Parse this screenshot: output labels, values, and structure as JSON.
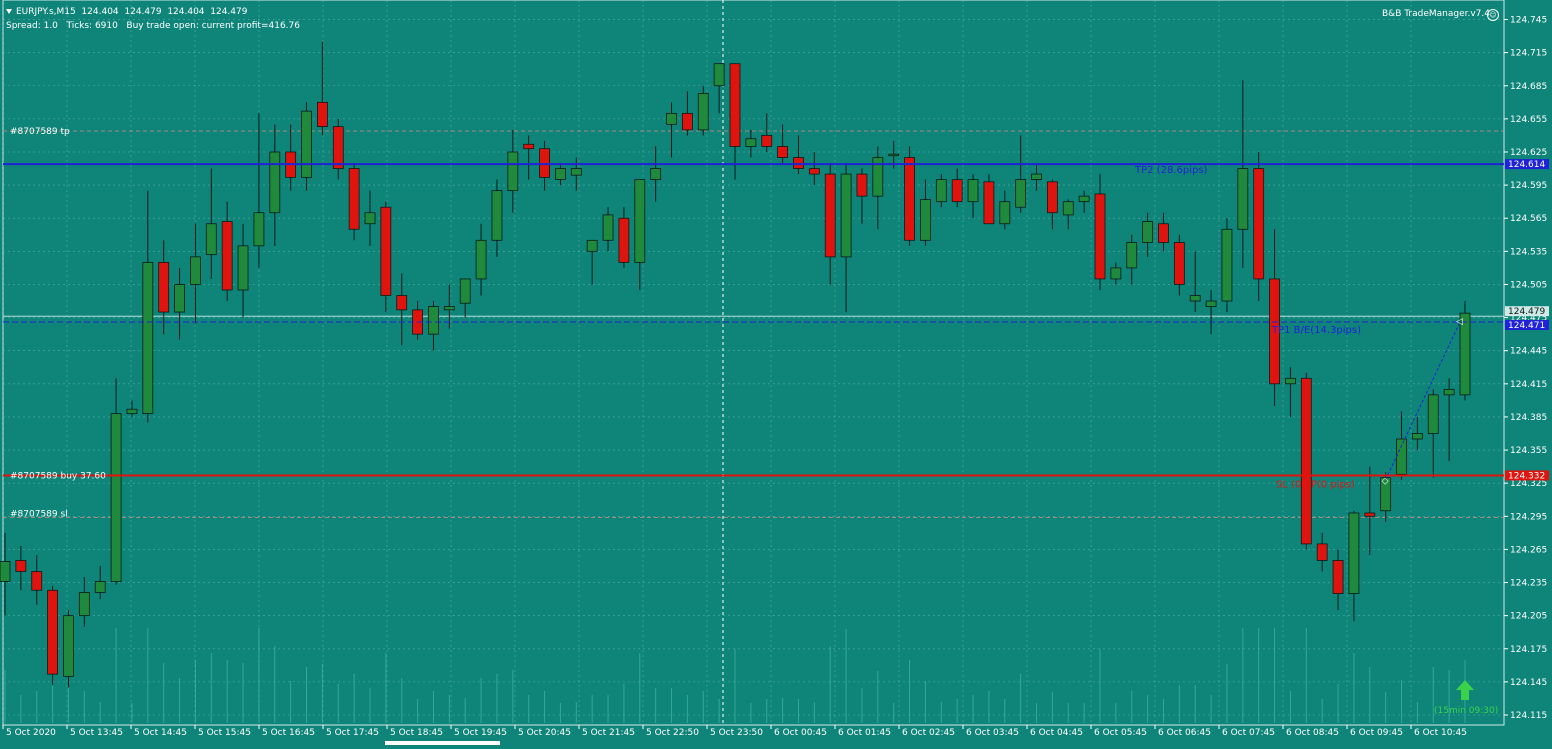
{
  "header": {
    "symbol_line": "EURJPY.s,M15  124.404  124.479  124.404  124.479",
    "info_line": "Spread: 1.0   Ticks: 6910   Buy trade open: current profit=416.76"
  },
  "panel": {
    "title": "B&B TradeManager.v7.4",
    "icon": "smiley-icon"
  },
  "orders": {
    "tp_label": "#8707589 tp",
    "buy_label": "#8707589 buy 37.60",
    "sl_label": "#8707589 sl",
    "tp2_label": "TP2 (28.6pips)",
    "tp1_label": "TP1 B/E(14.3pips)",
    "sl_label2": "SL (0.4P(0 pips)"
  },
  "countdown": "(15min 09:30)",
  "colors": {
    "background": "#0f857a",
    "bull": "#1f8a3b",
    "bear": "#e0140f",
    "tp_line": "#1f22d6",
    "sl_line": "#e0140f",
    "grid": "#7fc8c0"
  },
  "chart_data": {
    "type": "candlestick",
    "symbol": "EURJPY.s",
    "timeframe": "M15",
    "ylim": [
      124.115,
      124.75
    ],
    "y_ticks": [
      "124.745",
      "124.715",
      "124.685",
      "124.655",
      "124.625",
      "124.595",
      "124.565",
      "124.535",
      "124.505",
      "124.475",
      "124.445",
      "124.415",
      "124.385",
      "124.355",
      "124.325",
      "124.295",
      "124.265",
      "124.235",
      "124.205",
      "124.175",
      "124.145",
      "124.115"
    ],
    "x_ticks": [
      "5 Oct 2020",
      "5 Oct 13:45",
      "5 Oct 14:45",
      "5 Oct 15:45",
      "5 Oct 16:45",
      "5 Oct 17:45",
      "5 Oct 18:45",
      "5 Oct 19:45",
      "5 Oct 20:45",
      "5 Oct 21:45",
      "5 Oct 22:50",
      "5 Oct 23:50",
      "6 Oct 00:45",
      "6 Oct 01:45",
      "6 Oct 02:45",
      "6 Oct 03:45",
      "6 Oct 04:45",
      "6 Oct 05:45",
      "6 Oct 06:45",
      "6 Oct 07:45",
      "6 Oct 08:45",
      "6 Oct 09:45",
      "6 Oct 10:45"
    ],
    "price_labels": {
      "tp": "124.614",
      "bid": "124.479",
      "tp1": "124.471",
      "entry": "124.332"
    },
    "levels": {
      "tp": 124.614,
      "tp1": 124.471,
      "entry": 124.332,
      "sl": 124.294,
      "tp_dash": 124.644,
      "bid": 124.479
    },
    "candles": [
      {
        "o": 124.236,
        "h": 124.28,
        "l": 124.205,
        "c": 124.254
      },
      {
        "o": 124.255,
        "h": 124.268,
        "l": 124.228,
        "c": 124.245
      },
      {
        "o": 124.245,
        "h": 124.26,
        "l": 124.215,
        "c": 124.228
      },
      {
        "o": 124.228,
        "h": 124.232,
        "l": 124.142,
        "c": 124.152
      },
      {
        "o": 124.15,
        "h": 124.21,
        "l": 124.14,
        "c": 124.205
      },
      {
        "o": 124.205,
        "h": 124.24,
        "l": 124.195,
        "c": 124.226
      },
      {
        "o": 124.226,
        "h": 124.25,
        "l": 124.22,
        "c": 124.236
      },
      {
        "o": 124.236,
        "h": 124.42,
        "l": 124.233,
        "c": 124.388
      },
      {
        "o": 124.388,
        "h": 124.4,
        "l": 124.385,
        "c": 124.392
      },
      {
        "o": 124.388,
        "h": 124.59,
        "l": 124.38,
        "c": 124.525
      },
      {
        "o": 124.525,
        "h": 124.545,
        "l": 124.46,
        "c": 124.48
      },
      {
        "o": 124.48,
        "h": 124.52,
        "l": 124.455,
        "c": 124.505
      },
      {
        "o": 124.505,
        "h": 124.56,
        "l": 124.47,
        "c": 124.53
      },
      {
        "o": 124.532,
        "h": 124.61,
        "l": 124.51,
        "c": 124.56
      },
      {
        "o": 124.562,
        "h": 124.58,
        "l": 124.49,
        "c": 124.5
      },
      {
        "o": 124.5,
        "h": 124.56,
        "l": 124.475,
        "c": 124.54
      },
      {
        "o": 124.54,
        "h": 124.66,
        "l": 124.52,
        "c": 124.57
      },
      {
        "o": 124.57,
        "h": 124.65,
        "l": 124.54,
        "c": 124.625
      },
      {
        "o": 124.625,
        "h": 124.65,
        "l": 124.59,
        "c": 124.602
      },
      {
        "o": 124.602,
        "h": 124.67,
        "l": 124.59,
        "c": 124.662
      },
      {
        "o": 124.67,
        "h": 124.725,
        "l": 124.64,
        "c": 124.648
      },
      {
        "o": 124.648,
        "h": 124.655,
        "l": 124.6,
        "c": 124.61
      },
      {
        "o": 124.61,
        "h": 124.615,
        "l": 124.545,
        "c": 124.555
      },
      {
        "o": 124.56,
        "h": 124.59,
        "l": 124.54,
        "c": 124.57
      },
      {
        "o": 124.575,
        "h": 124.58,
        "l": 124.48,
        "c": 124.495
      },
      {
        "o": 124.495,
        "h": 124.515,
        "l": 124.45,
        "c": 124.482
      },
      {
        "o": 124.482,
        "h": 124.49,
        "l": 124.455,
        "c": 124.46
      },
      {
        "o": 124.46,
        "h": 124.49,
        "l": 124.445,
        "c": 124.485
      },
      {
        "o": 124.482,
        "h": 124.505,
        "l": 124.465,
        "c": 124.485
      },
      {
        "o": 124.488,
        "h": 124.51,
        "l": 124.475,
        "c": 124.51
      },
      {
        "o": 124.51,
        "h": 124.56,
        "l": 124.495,
        "c": 124.545
      },
      {
        "o": 124.545,
        "h": 124.6,
        "l": 124.53,
        "c": 124.59
      },
      {
        "o": 124.59,
        "h": 124.645,
        "l": 124.57,
        "c": 124.625
      },
      {
        "o": 124.632,
        "h": 124.64,
        "l": 124.6,
        "c": 124.628
      },
      {
        "o": 124.628,
        "h": 124.635,
        "l": 124.59,
        "c": 124.602
      },
      {
        "o": 124.6,
        "h": 124.615,
        "l": 124.595,
        "c": 124.61
      },
      {
        "o": 124.604,
        "h": 124.62,
        "l": 124.59,
        "c": 124.61
      },
      {
        "o": 124.535,
        "h": 124.545,
        "l": 124.505,
        "c": 124.545
      },
      {
        "o": 124.545,
        "h": 124.575,
        "l": 124.535,
        "c": 124.568
      },
      {
        "o": 124.565,
        "h": 124.575,
        "l": 124.52,
        "c": 124.525
      },
      {
        "o": 124.525,
        "h": 124.6,
        "l": 124.5,
        "c": 124.6
      },
      {
        "o": 124.6,
        "h": 124.63,
        "l": 124.58,
        "c": 124.61
      },
      {
        "o": 124.65,
        "h": 124.67,
        "l": 124.62,
        "c": 124.66
      },
      {
        "o": 124.66,
        "h": 124.68,
        "l": 124.64,
        "c": 124.645
      },
      {
        "o": 124.645,
        "h": 124.685,
        "l": 124.64,
        "c": 124.678
      },
      {
        "o": 124.685,
        "h": 124.695,
        "l": 124.66,
        "c": 124.705
      },
      {
        "o": 124.705,
        "h": 124.705,
        "l": 124.6,
        "c": 124.63
      },
      {
        "o": 124.63,
        "h": 124.645,
        "l": 124.62,
        "c": 124.637
      },
      {
        "o": 124.64,
        "h": 124.66,
        "l": 124.625,
        "c": 124.63
      },
      {
        "o": 124.63,
        "h": 124.65,
        "l": 124.615,
        "c": 124.62
      },
      {
        "o": 124.62,
        "h": 124.64,
        "l": 124.605,
        "c": 124.61
      },
      {
        "o": 124.61,
        "h": 124.625,
        "l": 124.595,
        "c": 124.605
      },
      {
        "o": 124.605,
        "h": 124.615,
        "l": 124.505,
        "c": 124.53
      },
      {
        "o": 124.53,
        "h": 124.615,
        "l": 124.48,
        "c": 124.605
      },
      {
        "o": 124.605,
        "h": 124.61,
        "l": 124.56,
        "c": 124.585
      },
      {
        "o": 124.585,
        "h": 124.63,
        "l": 124.555,
        "c": 124.62
      },
      {
        "o": 124.623,
        "h": 124.635,
        "l": 124.61,
        "c": 124.623
      },
      {
        "o": 124.62,
        "h": 124.63,
        "l": 124.54,
        "c": 124.545
      },
      {
        "o": 124.545,
        "h": 124.6,
        "l": 124.54,
        "c": 124.582
      },
      {
        "o": 124.58,
        "h": 124.605,
        "l": 124.575,
        "c": 124.6
      },
      {
        "o": 124.6,
        "h": 124.61,
        "l": 124.575,
        "c": 124.58
      },
      {
        "o": 124.58,
        "h": 124.605,
        "l": 124.565,
        "c": 124.6
      },
      {
        "o": 124.598,
        "h": 124.605,
        "l": 124.56,
        "c": 124.56
      },
      {
        "o": 124.56,
        "h": 124.59,
        "l": 124.555,
        "c": 124.58
      },
      {
        "o": 124.575,
        "h": 124.64,
        "l": 124.57,
        "c": 124.6
      },
      {
        "o": 124.6,
        "h": 124.615,
        "l": 124.59,
        "c": 124.605
      },
      {
        "o": 124.598,
        "h": 124.6,
        "l": 124.555,
        "c": 124.57
      },
      {
        "o": 124.568,
        "h": 124.582,
        "l": 124.555,
        "c": 124.58
      },
      {
        "o": 124.58,
        "h": 124.59,
        "l": 124.57,
        "c": 124.585
      },
      {
        "o": 124.587,
        "h": 124.605,
        "l": 124.5,
        "c": 124.51
      },
      {
        "o": 124.51,
        "h": 124.525,
        "l": 124.505,
        "c": 124.52
      },
      {
        "o": 124.52,
        "h": 124.55,
        "l": 124.505,
        "c": 124.543
      },
      {
        "o": 124.543,
        "h": 124.57,
        "l": 124.53,
        "c": 124.562
      },
      {
        "o": 124.56,
        "h": 124.57,
        "l": 124.535,
        "c": 124.543
      },
      {
        "o": 124.543,
        "h": 124.55,
        "l": 124.495,
        "c": 124.505
      },
      {
        "o": 124.49,
        "h": 124.535,
        "l": 124.48,
        "c": 124.495
      },
      {
        "o": 124.485,
        "h": 124.5,
        "l": 124.46,
        "c": 124.49
      },
      {
        "o": 124.49,
        "h": 124.565,
        "l": 124.48,
        "c": 124.555
      },
      {
        "o": 124.555,
        "h": 124.69,
        "l": 124.52,
        "c": 124.61
      },
      {
        "o": 124.61,
        "h": 124.625,
        "l": 124.49,
        "c": 124.51
      },
      {
        "o": 124.51,
        "h": 124.555,
        "l": 124.395,
        "c": 124.415
      },
      {
        "o": 124.415,
        "h": 124.43,
        "l": 124.385,
        "c": 124.42
      },
      {
        "o": 124.42,
        "h": 124.425,
        "l": 124.265,
        "c": 124.27
      },
      {
        "o": 124.27,
        "h": 124.28,
        "l": 124.245,
        "c": 124.255
      },
      {
        "o": 124.255,
        "h": 124.265,
        "l": 124.21,
        "c": 124.225
      },
      {
        "o": 124.225,
        "h": 124.3,
        "l": 124.2,
        "c": 124.298
      },
      {
        "o": 124.298,
        "h": 124.34,
        "l": 124.26,
        "c": 124.295
      },
      {
        "o": 124.3,
        "h": 124.335,
        "l": 124.29,
        "c": 124.33
      },
      {
        "o": 124.333,
        "h": 124.39,
        "l": 124.328,
        "c": 124.365
      },
      {
        "o": 124.365,
        "h": 124.385,
        "l": 124.355,
        "c": 124.37
      },
      {
        "o": 124.37,
        "h": 124.41,
        "l": 124.33,
        "c": 124.405
      },
      {
        "o": 124.405,
        "h": 124.42,
        "l": 124.345,
        "c": 124.41
      },
      {
        "o": 124.405,
        "h": 124.49,
        "l": 124.4,
        "c": 124.479
      }
    ]
  }
}
